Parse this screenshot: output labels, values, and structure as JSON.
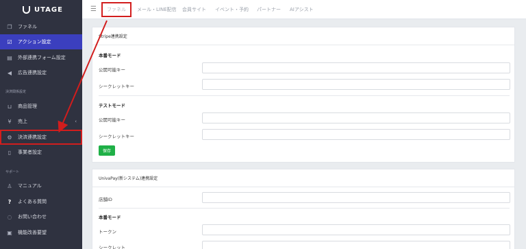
{
  "brand": {
    "name": "UTAGE"
  },
  "sidebar": {
    "items": [
      {
        "label": "ファネル",
        "icon": "copy-icon"
      },
      {
        "label": "アクション設定",
        "icon": "checkbox-icon"
      },
      {
        "label": "外部連携フォーム設定",
        "icon": "form-icon"
      },
      {
        "label": "広告連携設定",
        "icon": "megaphone-icon"
      }
    ],
    "payment_section_label": "決済関係設定",
    "payment_items": [
      {
        "label": "商品管理",
        "icon": "basket-icon"
      },
      {
        "label": "売上",
        "icon": "yen-icon"
      },
      {
        "label": "決済連携設定",
        "icon": "gear-icon"
      },
      {
        "label": "事業者設定",
        "icon": "building-icon"
      }
    ],
    "support_section_label": "サポート",
    "support_items": [
      {
        "label": "マニュアル",
        "icon": "person-icon"
      },
      {
        "label": "よくある質問",
        "icon": "question-icon"
      },
      {
        "label": "お問い合わせ",
        "icon": "chat-icon"
      },
      {
        "label": "機能改善要望",
        "icon": "document-icon"
      }
    ]
  },
  "topbar": {
    "tabs": [
      "ファネル",
      "メール・LINE配信",
      "会員サイト",
      "イベント・予約",
      "パートナー",
      "AIアシスト"
    ]
  },
  "stripe": {
    "title": "Stripe連携設定",
    "live_heading": "本番モード",
    "publishable_key_label": "公開可能キー",
    "secret_key_label": "シークレットキー",
    "test_heading": "テストモード",
    "test_publishable_key_label": "公開可能キー",
    "test_secret_key_label": "シークレットキー",
    "save_label": "保存"
  },
  "univapay": {
    "title": "UnivaPay(新システム)連携設定",
    "store_id_label": "店舗ID",
    "live_heading": "本番モード",
    "token_label": "トークン",
    "secret_label": "シークレット"
  },
  "colors": {
    "sidebar_bg": "#2f3240",
    "active_bg": "#3b3fbe",
    "annotation_red": "#d21d1d",
    "save_green": "#1fb047"
  }
}
